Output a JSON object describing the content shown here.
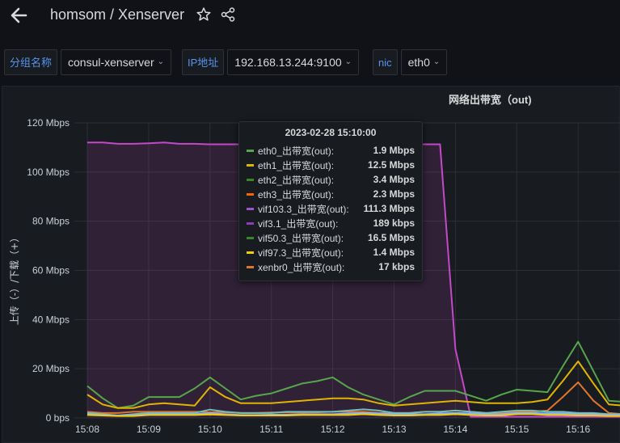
{
  "header": {
    "breadcrumb": "homsom / Xenserver"
  },
  "variables": [
    {
      "label": "分组名称",
      "value": "consul-xenserver"
    },
    {
      "label": "IP地址",
      "value": "192.168.13.244:9100"
    },
    {
      "label": "nic",
      "value": "eth0"
    }
  ],
  "icons": {
    "back": "arrow-left-icon",
    "star": "star-icon",
    "share": "share-icon",
    "dropdown": "chevron-down-icon"
  },
  "panel": {
    "title": "网络出带宽（out)"
  },
  "tooltip": {
    "time": "2023-02-28 15:10:00",
    "rows": [
      {
        "name": "eth0_出带宽(out):",
        "value": "1.9 Mbps",
        "color": "#56a64b"
      },
      {
        "name": "eth1_出带宽(out):",
        "value": "12.5 Mbps",
        "color": "#e0b400"
      },
      {
        "name": "eth2_出带宽(out):",
        "value": "3.4 Mbps",
        "color": "#37872d"
      },
      {
        "name": "eth3_出带宽(out):",
        "value": "2.3 Mbps",
        "color": "#fa6400"
      },
      {
        "name": "vif103.3_出带宽(out):",
        "value": "111.3 Mbps",
        "color": "#a352cc"
      },
      {
        "name": "vif3.1_出带宽(out):",
        "value": "189 kbps",
        "color": "#8f3bb8"
      },
      {
        "name": "vif50.3_出带宽(out):",
        "value": "16.5 Mbps",
        "color": "#37872d"
      },
      {
        "name": "vif97.3_出带宽(out):",
        "value": "1.4 Mbps",
        "color": "#f2cc0c"
      },
      {
        "name": "xenbr0_出带宽(out):",
        "value": "17 kbps",
        "color": "#e0752d"
      }
    ]
  },
  "chart_data": {
    "type": "line",
    "ylabel": "上传（-）/下载（+）",
    "ylim": [
      0,
      120
    ],
    "yticks": [
      "0 bps",
      "20 Mbps",
      "40 Mbps",
      "60 Mbps",
      "80 Mbps",
      "100 Mbps",
      "120 Mbps"
    ],
    "xticks": [
      "15:08",
      "15:09",
      "15:10",
      "15:11",
      "15:12",
      "15:13",
      "15:14",
      "15:15",
      "15:16"
    ],
    "x": [
      0,
      0.25,
      0.5,
      0.75,
      1,
      1.25,
      1.5,
      1.75,
      2,
      2.25,
      2.5,
      2.75,
      3,
      3.25,
      3.5,
      3.75,
      4,
      4.25,
      4.5,
      4.75,
      5,
      5.25,
      5.5,
      5.75,
      6,
      6.25,
      6.5,
      6.75,
      7,
      7.25,
      7.5,
      7.75,
      8,
      8.25,
      8.5,
      8.75
    ],
    "series": [
      {
        "name": "vif103.3_出带宽(out)",
        "color": "#c448c9",
        "fill": true,
        "values": [
          112,
          112,
          111.5,
          111.5,
          111.7,
          112,
          111.5,
          111.5,
          111.3,
          111.3,
          111.3,
          111.3,
          111.3,
          111.3,
          111.3,
          111.3,
          111.3,
          111.3,
          111.3,
          111.3,
          111.3,
          111.3,
          111.3,
          111.3,
          28,
          0.5,
          0.5,
          0.5,
          0.5,
          0.5,
          0.5,
          0.5,
          0.5,
          0.5,
          0.5,
          0.5
        ]
      },
      {
        "name": "vif50.3_出带宽(out)",
        "color": "#56a64b",
        "fill": false,
        "values": [
          13,
          8,
          4,
          5,
          8.5,
          8.5,
          8.5,
          12,
          16.5,
          12,
          7.5,
          9,
          10,
          12,
          14,
          15,
          16.5,
          12.5,
          9.5,
          7.5,
          5.5,
          8.5,
          11,
          11,
          11,
          9,
          7,
          9.5,
          11.5,
          11,
          10.5,
          21,
          31,
          19,
          7,
          6.5
        ]
      },
      {
        "name": "eth1_出带宽(out)",
        "color": "#e0b400",
        "fill": false,
        "values": [
          9.5,
          5.5,
          4,
          4,
          5.5,
          6,
          5.5,
          5,
          12.5,
          8.5,
          6,
          6,
          6,
          6.5,
          7,
          7.5,
          8,
          8,
          7.5,
          6,
          5,
          5.5,
          6,
          6.5,
          7,
          6.5,
          6,
          6,
          6,
          6.5,
          7.5,
          15,
          23,
          14,
          5.5,
          5
        ]
      },
      {
        "name": "eth3_出带宽(out)",
        "color": "#e0752d",
        "fill": false,
        "values": [
          2.5,
          2,
          2,
          2.5,
          2.5,
          2.5,
          2.5,
          2.5,
          2.3,
          2.3,
          2,
          2,
          2.2,
          2.2,
          2.2,
          2.3,
          2.5,
          2.5,
          2.5,
          2,
          2,
          2,
          2.5,
          2.5,
          3,
          2.5,
          2,
          2,
          2.5,
          2.5,
          3,
          8.5,
          14.5,
          7,
          2,
          1.5
        ]
      },
      {
        "name": "eth2_出带宽(out)",
        "color": "#73bfb8",
        "fill": false,
        "values": [
          2,
          1.5,
          1,
          1.5,
          2,
          2,
          2,
          2,
          3.4,
          2.5,
          2,
          2,
          2,
          2.5,
          2.5,
          2.5,
          2.5,
          3,
          3.5,
          3,
          2,
          2,
          2.5,
          2.5,
          3,
          2.5,
          2,
          2.5,
          3,
          3,
          2.5,
          2.5,
          2,
          2,
          1.5,
          1.5
        ]
      },
      {
        "name": "eth0_出带宽(out)",
        "color": "#8ab8ff",
        "fill": false,
        "values": [
          1.5,
          1.2,
          1,
          1,
          1.5,
          1.5,
          1.5,
          1.5,
          1.9,
          1.5,
          1.2,
          1.2,
          1.3,
          1.3,
          1.5,
          1.5,
          1.5,
          1.8,
          2,
          1.8,
          1.5,
          1.5,
          1.5,
          1.8,
          2,
          1.8,
          1.5,
          1.5,
          2,
          2,
          1.8,
          1.8,
          1.5,
          1.5,
          1.2,
          1.2
        ]
      },
      {
        "name": "vif97.3_出带宽(out)",
        "color": "#f2cc0c",
        "fill": false,
        "values": [
          1.2,
          1,
          0.8,
          0.8,
          1.2,
          1.2,
          1.2,
          1.2,
          1.4,
          1.2,
          1,
          1,
          1,
          1,
          1.2,
          1.2,
          1.2,
          1.2,
          1.5,
          1.2,
          1,
          1,
          1.2,
          1.2,
          1.5,
          1.2,
          1,
          1,
          1.5,
          1.5,
          1.2,
          1.2,
          1,
          1,
          0.8,
          0.8
        ]
      }
    ]
  }
}
